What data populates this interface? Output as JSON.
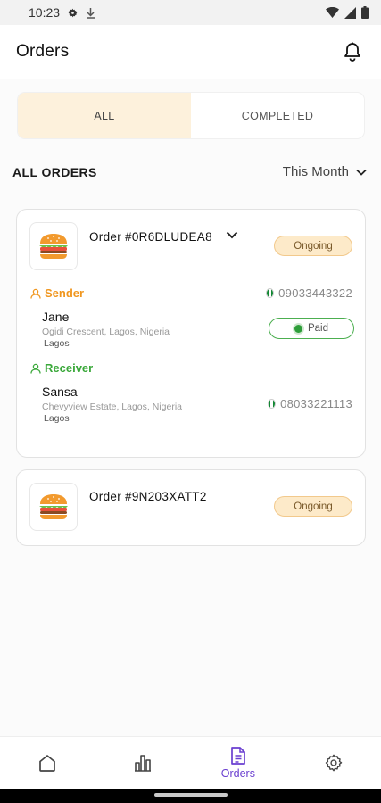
{
  "status_bar": {
    "time": "10:23"
  },
  "header": {
    "title": "Orders"
  },
  "tabs": [
    {
      "label": "ALL",
      "active": true
    },
    {
      "label": "COMPLETED",
      "active": false
    }
  ],
  "section": {
    "title": "ALL ORDERS",
    "filter": "This Month"
  },
  "orders": [
    {
      "title": "Order #0R6DLUDEA8",
      "status": "Ongoing",
      "sender": {
        "role_label": "Sender",
        "name": "Jane",
        "address": "Ogidi Crescent, Lagos, Nigeria",
        "city": "Lagos",
        "phone": "09033443322"
      },
      "payment": "Paid",
      "receiver": {
        "role_label": "Receiver",
        "name": "Sansa",
        "address": "Chevyview Estate, Lagos, Nigeria",
        "city": "Lagos",
        "phone": "08033221113"
      }
    },
    {
      "title": "Order #9N203XATT2",
      "status": "Ongoing"
    }
  ],
  "nav": [
    {
      "icon": "home-icon",
      "label": ""
    },
    {
      "icon": "chart-icon",
      "label": ""
    },
    {
      "icon": "document-icon",
      "label": "Orders",
      "active": true
    },
    {
      "icon": "gear-icon",
      "label": ""
    }
  ],
  "colors": {
    "accent_purple": "#6a3fd0",
    "sender_orange": "#f0961e",
    "receiver_green": "#3aa83a",
    "badge_bg": "#fdeac9",
    "tab_active_bg": "#fdf1dc"
  }
}
